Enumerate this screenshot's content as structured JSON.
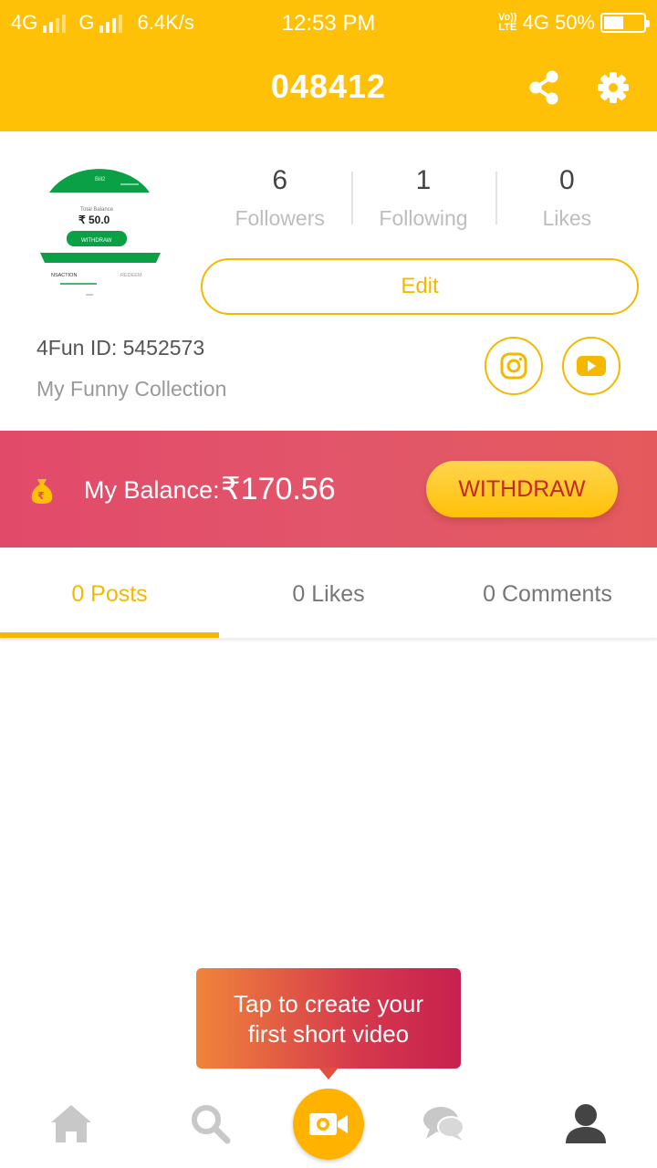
{
  "status_bar": {
    "network_1": "4G",
    "network_2": "G",
    "speed": "6.4K/s",
    "time": "12:53 PM",
    "volte_top": "Vo))",
    "volte_bottom": "LTE",
    "network_3": "4G",
    "battery": "50%",
    "battery_level": 0.5
  },
  "header": {
    "title": "048412",
    "share_icon": "share-icon",
    "settings_icon": "gear-icon"
  },
  "profile": {
    "stats": [
      {
        "value": "6",
        "label": "Followers"
      },
      {
        "value": "1",
        "label": "Following"
      },
      {
        "value": "0",
        "label": "Likes"
      }
    ],
    "edit_label": "Edit",
    "user_id": "4Fun ID: 5452573",
    "bio": "My Funny Collection",
    "avatar_text": {
      "top": "Bill2",
      "balance_label": "Total Balance",
      "balance": "₹ 50.0",
      "button": "WITHDRAW",
      "tab_left": "NSACTION",
      "tab_right": "REDEEM"
    }
  },
  "balance": {
    "label": "My Balance:",
    "amount": "₹170.56",
    "withdraw_label": "WITHDRAW"
  },
  "tabs": [
    {
      "label": "0 Posts",
      "active": true
    },
    {
      "label": "0 Likes",
      "active": false
    },
    {
      "label": "0 Comments",
      "active": false
    }
  ],
  "tooltip": {
    "line1": "Tap to create your",
    "line2": "first short video"
  },
  "bottom_nav": [
    {
      "icon": "home-icon"
    },
    {
      "icon": "search-icon"
    },
    {
      "icon": "video-camera-icon"
    },
    {
      "icon": "chat-icon"
    },
    {
      "icon": "user-icon"
    }
  ],
  "colors": {
    "brand_yellow": "#FFC107",
    "accent_yellow": "#F5B800",
    "balance_red": "#E24A6A",
    "withdraw_text": "#C62828"
  }
}
